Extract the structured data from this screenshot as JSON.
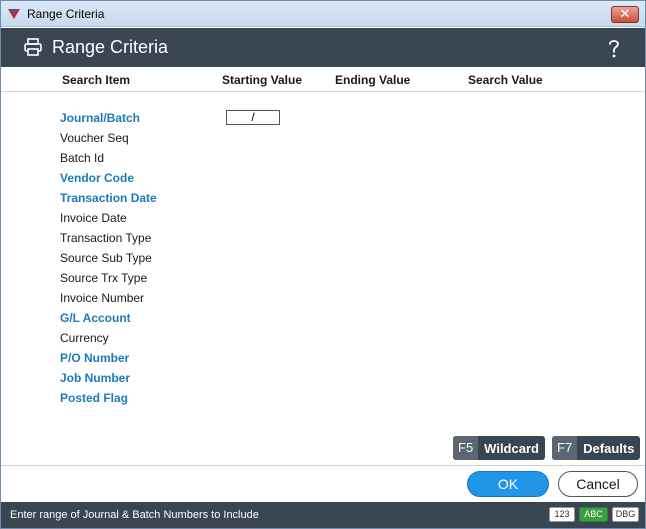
{
  "window": {
    "title": "Range Criteria",
    "close_label": "✕"
  },
  "header": {
    "title": "Range Criteria",
    "help_label": "?"
  },
  "columns": {
    "search_item": "Search Item",
    "starting_value": "Starting Value",
    "ending_value": "Ending Value",
    "search_value": "Search Value"
  },
  "items": [
    {
      "label": "Journal/Batch",
      "key": true
    },
    {
      "label": "Voucher Seq",
      "key": false
    },
    {
      "label": "Batch Id",
      "key": false
    },
    {
      "label": "Vendor Code",
      "key": true
    },
    {
      "label": "Transaction Date",
      "key": true
    },
    {
      "label": "Invoice Date",
      "key": false
    },
    {
      "label": "Transaction Type",
      "key": false
    },
    {
      "label": "Source Sub Type",
      "key": false
    },
    {
      "label": "Source Trx Type",
      "key": false
    },
    {
      "label": "Invoice Number",
      "key": false
    },
    {
      "label": "G/L Account",
      "key": true
    },
    {
      "label": "Currency",
      "key": false
    },
    {
      "label": "P/O Number",
      "key": true
    },
    {
      "label": "Job Number",
      "key": true
    },
    {
      "label": "Posted Flag",
      "key": true
    }
  ],
  "journal_batch_start": "/",
  "fkeys": {
    "wildcard": {
      "key": "F5",
      "label": "Wildcard"
    },
    "defaults": {
      "key": "F7",
      "label": "Defaults"
    }
  },
  "buttons": {
    "ok": "OK",
    "cancel": "Cancel"
  },
  "status": {
    "message": "Enter range of Journal & Batch Numbers to Include",
    "badge_123": "123",
    "badge_abc": "ABC",
    "badge_dbg": "DBG"
  },
  "colors": {
    "header_bg": "#3a4552",
    "key_field": "#1f7ab8",
    "ok_button": "#2196e8",
    "abc_badge": "#3aa041"
  }
}
